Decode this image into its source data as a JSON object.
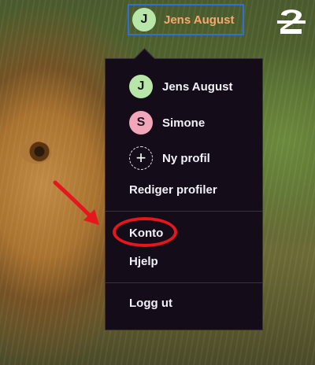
{
  "header": {
    "profile_initial": "J",
    "profile_name": "Jens August",
    "logo_text": "2"
  },
  "menu": {
    "profiles": [
      {
        "initial": "J",
        "name": "Jens August",
        "color": "#b8e6a8"
      },
      {
        "initial": "S",
        "name": "Simone",
        "color": "#f2a6b9"
      }
    ],
    "new_profile": {
      "icon": "+",
      "label": "Ny profil"
    },
    "edit_profiles": "Rediger profiler",
    "account": "Konto",
    "help": "Hjelp",
    "logout": "Logg ut"
  },
  "colors": {
    "menu_bg": "#140c18",
    "accent_name": "#f6a96b",
    "focus_border": "#2f6fd8",
    "annotation_red": "#e5161c"
  }
}
